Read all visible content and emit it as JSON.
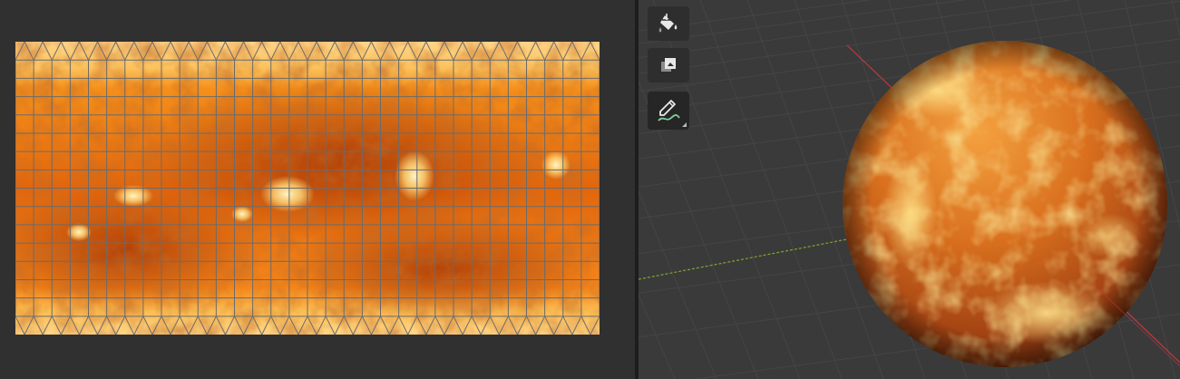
{
  "uv_editor": {
    "grid": {
      "columns": 32,
      "rows": 16
    }
  },
  "viewport": {
    "tools": [
      {
        "id": "fill",
        "icon": "paint-bucket-icon"
      },
      {
        "id": "mask",
        "icon": "layers-icon"
      },
      {
        "id": "annotate",
        "icon": "annotate-pen-icon",
        "active": true
      }
    ],
    "axis_colors": {
      "x": "#c0393e",
      "y": "#7fa62e"
    }
  },
  "colors": {
    "editor_bg": "#303030",
    "viewport_bg": "#3a3a3a",
    "texture_light": "#ffd589",
    "texture_mid": "#f27d10",
    "texture_dark": "#b13f06"
  }
}
